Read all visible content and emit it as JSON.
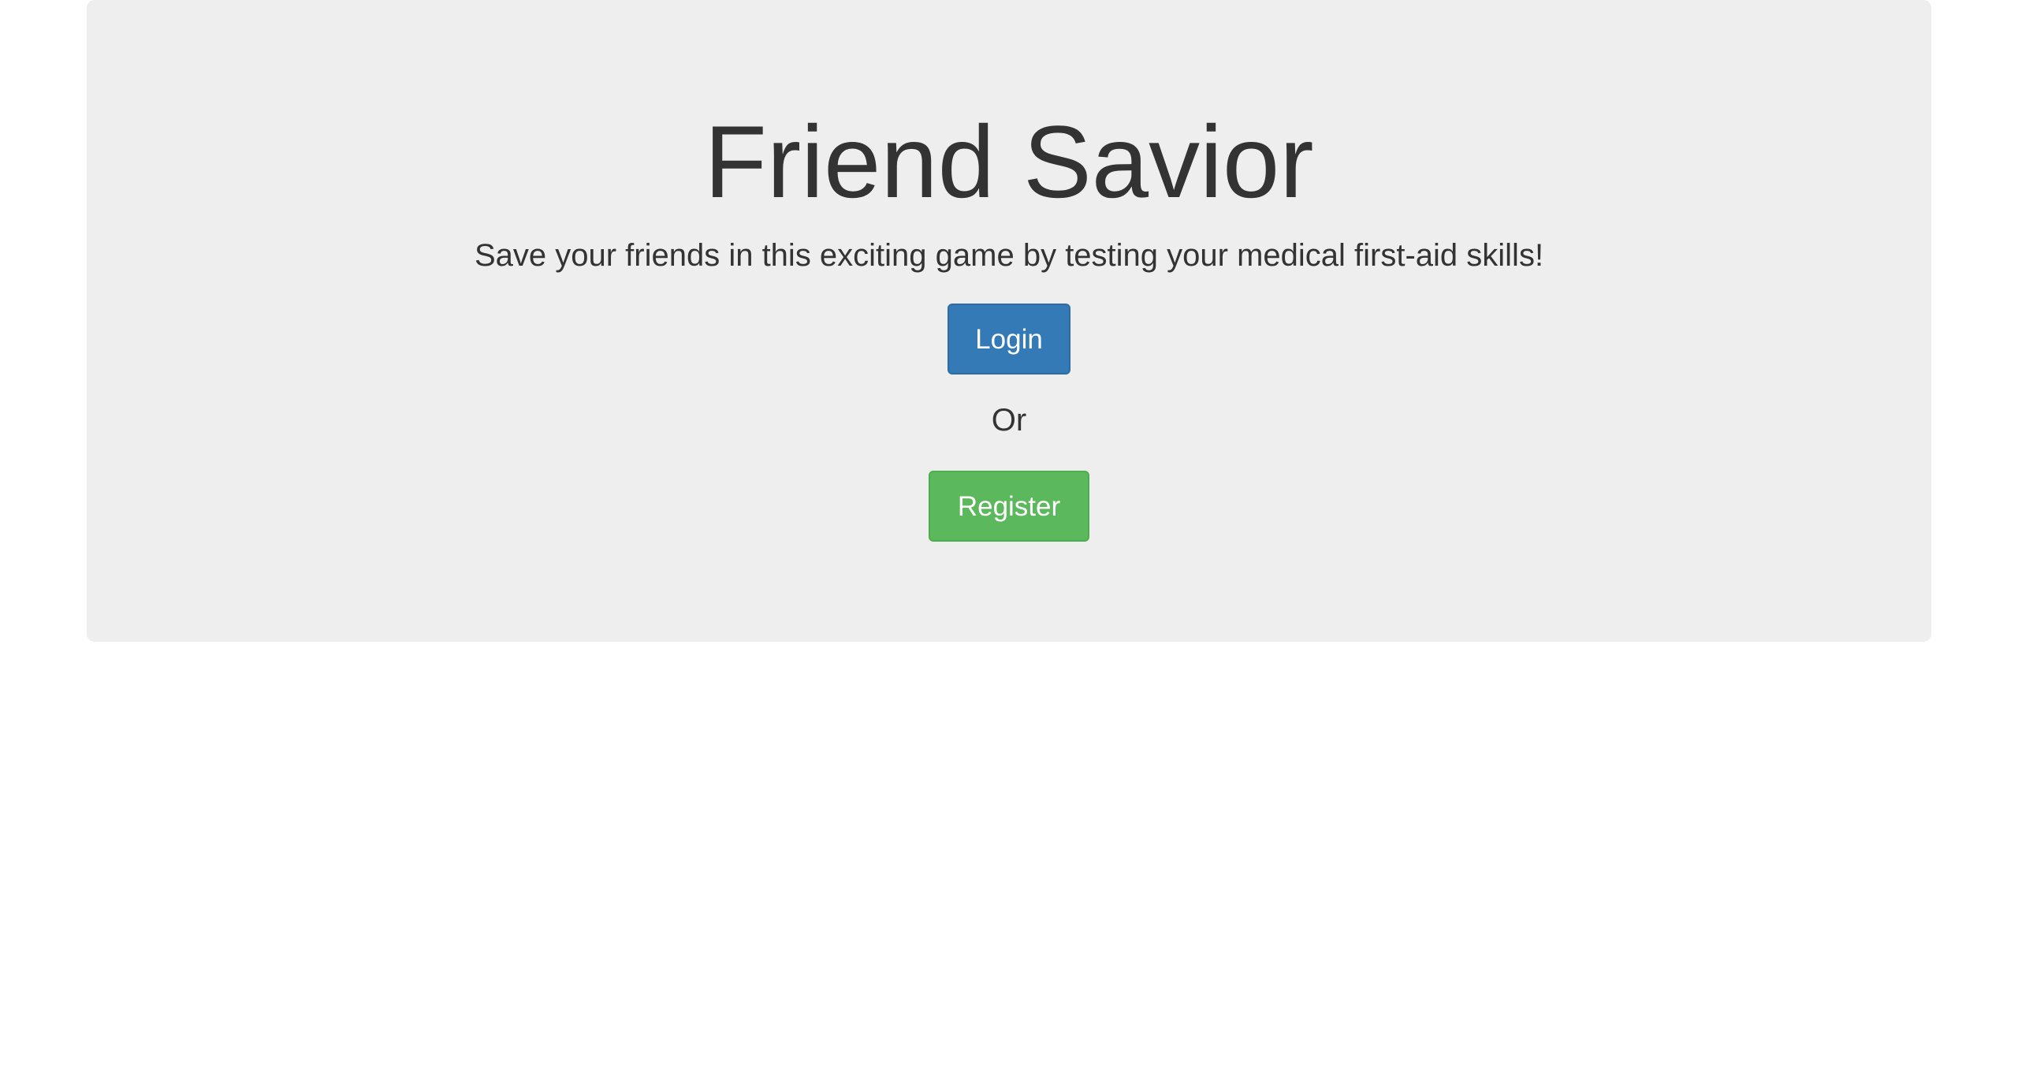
{
  "hero": {
    "title": "Friend Savior",
    "subtitle": "Save your friends in this exciting game by testing your medical first-aid skills!",
    "login_label": "Login",
    "or_text": "Or",
    "register_label": "Register"
  },
  "colors": {
    "panel_background": "#eeeeee",
    "login_button": "#337ab7",
    "register_button": "#5cb85c",
    "text": "#333333"
  }
}
